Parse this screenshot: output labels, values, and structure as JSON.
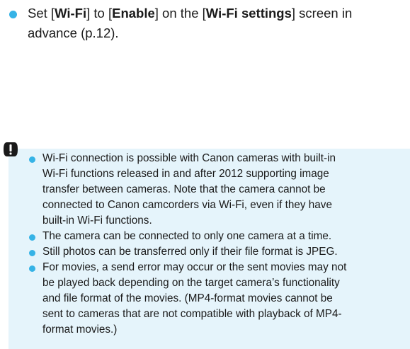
{
  "top_bullet": {
    "line1_parts": [
      "Set [",
      "Wi-Fi",
      "] to [",
      "Enable",
      "] on the [",
      "Wi-Fi settings",
      "] screen in"
    ],
    "line2": "advance (p.12)."
  },
  "caution": {
    "icon": "caution-icon",
    "items": [
      {
        "lines": [
          "Wi-Fi connection is possible with Canon cameras with built-in",
          "Wi-Fi functions released in and after 2012 supporting image",
          "transfer between cameras. Note that the camera cannot be",
          "connected to Canon camcorders via Wi-Fi, even if they have",
          "built-in Wi-Fi functions."
        ]
      },
      {
        "lines": [
          "The camera can be connected to only one camera at a time."
        ]
      },
      {
        "lines": [
          "Still photos can be transferred only if their file format is JPEG."
        ]
      },
      {
        "lines": [
          "For movies, a send error may occur or the sent movies may not",
          "be played back depending on the target camera’s functionality",
          "and file format of the movies. (MP4-format movies cannot be",
          "sent to cameras that are not compatible with playback of MP4-",
          "format movies.)"
        ]
      }
    ]
  },
  "colors": {
    "bullet": "#36b3e6",
    "caution_bg": "#e5f4fb",
    "text": "#1a1a1a"
  }
}
